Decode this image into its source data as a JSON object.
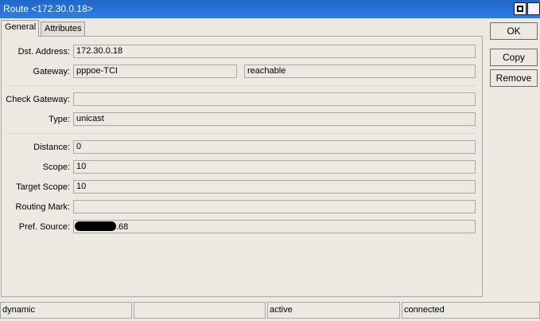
{
  "window": {
    "title": "Route <172.30.0.18>"
  },
  "tabs": [
    {
      "label": "General"
    },
    {
      "label": "Attributes"
    }
  ],
  "form": {
    "dst_address": {
      "label": "Dst. Address:",
      "value": "172.30.0.18"
    },
    "gateway": {
      "label": "Gateway:",
      "value": "pppoe-TCI",
      "status": "reachable"
    },
    "check_gateway": {
      "label": "Check Gateway:",
      "value": ""
    },
    "type": {
      "label": "Type:",
      "value": "unicast"
    },
    "distance": {
      "label": "Distance:",
      "value": "0"
    },
    "scope": {
      "label": "Scope:",
      "value": "10"
    },
    "target_scope": {
      "label": "Target Scope:",
      "value": "10"
    },
    "routing_mark": {
      "label": "Routing Mark:",
      "value": ""
    },
    "pref_source": {
      "label": "Pref. Source:",
      "value_suffix": ".68"
    }
  },
  "buttons": {
    "ok": "OK",
    "copy": "Copy",
    "remove": "Remove"
  },
  "status_bar": {
    "cell1": "dynamic",
    "cell2": "",
    "cell3": "active",
    "cell4": "connected"
  }
}
